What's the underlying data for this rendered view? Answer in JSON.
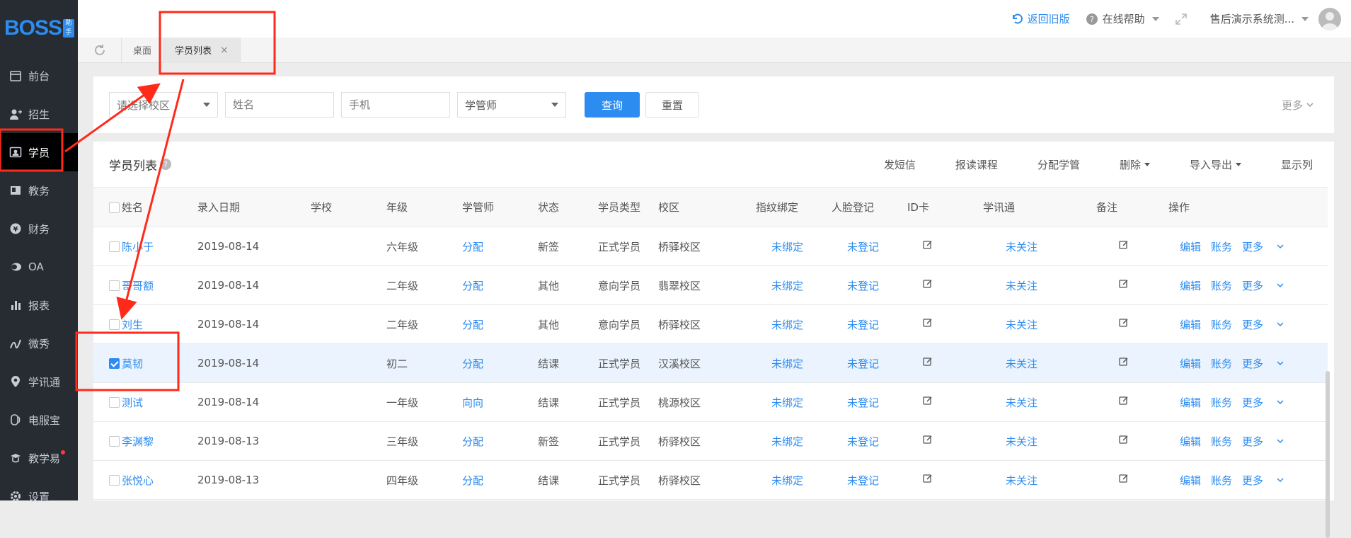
{
  "brand": {
    "logo_text": "BOSS",
    "logo_badge": "助手"
  },
  "sidebar": {
    "items": [
      {
        "label": "前台",
        "icon": "calendar-icon"
      },
      {
        "label": "招生",
        "icon": "user-add-icon"
      },
      {
        "label": "学员",
        "icon": "id-card-icon",
        "active": true
      },
      {
        "label": "教务",
        "icon": "book-icon"
      },
      {
        "label": "财务",
        "icon": "yen-icon"
      },
      {
        "label": "OA",
        "icon": "chat-icon"
      },
      {
        "label": "报表",
        "icon": "bar-chart-icon"
      },
      {
        "label": "微秀",
        "icon": "wave-icon"
      },
      {
        "label": "学讯通",
        "icon": "location-icon"
      },
      {
        "label": "电服宝",
        "icon": "phone-icon"
      },
      {
        "label": "教学易",
        "icon": "teach-icon",
        "dot": true
      },
      {
        "label": "设置",
        "icon": "gear-icon"
      }
    ]
  },
  "topbar": {
    "back_label": "返回旧版",
    "help_label": "在线帮助",
    "user_label": "售后演示系统测..."
  },
  "tabs": {
    "items": [
      {
        "label": "桌面"
      },
      {
        "label": "学员列表",
        "closable": true,
        "active": true
      }
    ]
  },
  "filter": {
    "campus_placeholder": "请选择校区",
    "name_placeholder": "姓名",
    "phone_placeholder": "手机",
    "manager_label": "学管师",
    "search_label": "查询",
    "reset_label": "重置",
    "more_label": "更多"
  },
  "panel": {
    "title": "学员列表",
    "actions": [
      "发短信",
      "报读课程",
      "分配学管",
      "删除",
      "导入导出",
      "显示列"
    ]
  },
  "table": {
    "headers": [
      "姓名",
      "录入日期",
      "学校",
      "年级",
      "学管师",
      "状态",
      "学员类型",
      "校区",
      "指纹绑定",
      "人脸登记",
      "ID卡",
      "学讯通",
      "备注",
      "操作"
    ],
    "rows": [
      {
        "name": "陈小于",
        "date": "2019-08-14",
        "school": "",
        "grade": "六年级",
        "manager": "分配",
        "status": "新签",
        "type": "正式学员",
        "campus": "桥驿校区",
        "fp": "未绑定",
        "face": "未登记",
        "wx": "未关注",
        "checked": false
      },
      {
        "name": "哥哥额",
        "date": "2019-08-14",
        "school": "",
        "grade": "二年级",
        "manager": "分配",
        "status": "其他",
        "type": "意向学员",
        "campus": "翡翠校区",
        "fp": "未绑定",
        "face": "未登记",
        "wx": "未关注",
        "checked": false
      },
      {
        "name": "刘生",
        "date": "2019-08-14",
        "school": "",
        "grade": "二年级",
        "manager": "分配",
        "status": "其他",
        "type": "意向学员",
        "campus": "桥驿校区",
        "fp": "未绑定",
        "face": "未登记",
        "wx": "未关注",
        "checked": false
      },
      {
        "name": "莫韧",
        "date": "2019-08-14",
        "school": "",
        "grade": "初二",
        "manager": "分配",
        "status": "结课",
        "type": "正式学员",
        "campus": "汉溪校区",
        "fp": "未绑定",
        "face": "未登记",
        "wx": "未关注",
        "checked": true
      },
      {
        "name": "测试",
        "date": "2019-08-14",
        "school": "",
        "grade": "一年级",
        "manager": "向向",
        "status": "结课",
        "type": "正式学员",
        "campus": "桃源校区",
        "fp": "未绑定",
        "face": "未登记",
        "wx": "未关注",
        "checked": false
      },
      {
        "name": "李渊黎",
        "date": "2019-08-13",
        "school": "",
        "grade": "三年级",
        "manager": "分配",
        "status": "新签",
        "type": "正式学员",
        "campus": "桥驿校区",
        "fp": "未绑定",
        "face": "未登记",
        "wx": "未关注",
        "checked": false
      },
      {
        "name": "张悦心",
        "date": "2019-08-13",
        "school": "",
        "grade": "四年级",
        "manager": "分配",
        "status": "结课",
        "type": "正式学员",
        "campus": "桥驿校区",
        "fp": "未绑定",
        "face": "未登记",
        "wx": "未关注",
        "checked": false
      }
    ],
    "ops": {
      "edit": "编辑",
      "account": "账务",
      "more": "更多"
    }
  },
  "colors": {
    "accent": "#2d8cf0",
    "sidebar_bg": "#272c33",
    "annotation": "#ff2a1a"
  }
}
